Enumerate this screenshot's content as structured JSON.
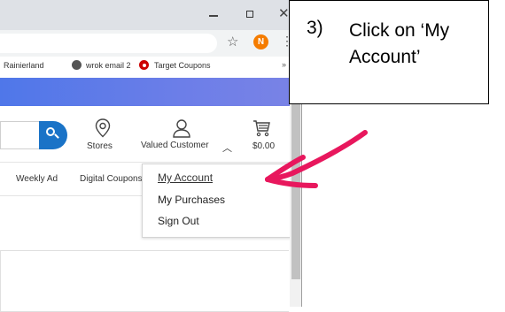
{
  "browser": {
    "bookmarks": [
      {
        "label": "Rainierland"
      },
      {
        "label": "wrok email 2"
      },
      {
        "label": "Target Coupons"
      }
    ],
    "bookmarks_more": "»",
    "profile_initial": "N"
  },
  "header": {
    "stores_label": "Stores",
    "account_label": "Valued Customer",
    "cart_total": "$0.00"
  },
  "nav": {
    "items": [
      {
        "label": "Weekly Ad"
      },
      {
        "label": "Digital Coupons"
      }
    ]
  },
  "account_menu": {
    "items": [
      {
        "label": "My Account"
      },
      {
        "label": "My Purchases"
      },
      {
        "label": "Sign Out"
      }
    ]
  },
  "instruction": {
    "step": "3)",
    "text": "Click on ‘My Account’"
  },
  "colors": {
    "banner": "#4f77e9",
    "search_button": "#1a73c7",
    "annotation_arrow": "#e8175d",
    "target_red": "#cc0000",
    "profile_orange": "#f57c00"
  }
}
